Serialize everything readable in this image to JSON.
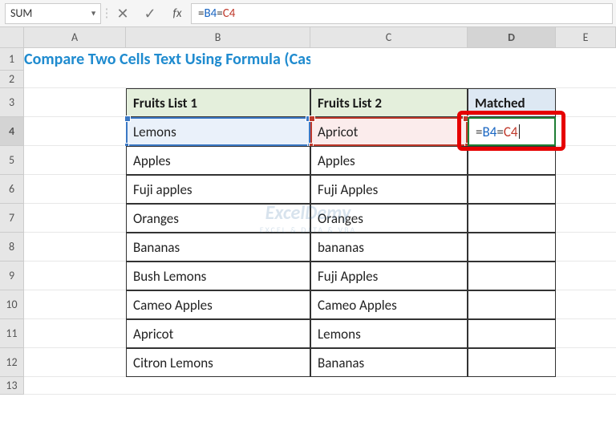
{
  "name_box": "SUM",
  "formula_bar": {
    "raw": "=B4=C4",
    "ref1": "B4",
    "ref2": "C4"
  },
  "columns": [
    "A",
    "B",
    "C",
    "D",
    "E"
  ],
  "rows": [
    "1",
    "2",
    "3",
    "4",
    "5",
    "6",
    "7",
    "8",
    "9",
    "10",
    "11",
    "12",
    "13"
  ],
  "title": "Compare Two Cells Text Using Formula (Case Insensitive)",
  "headers": {
    "b": "Fruits List 1",
    "c": "Fruits List 2",
    "d": "Matched"
  },
  "data": {
    "b": [
      "Lemons",
      "Apples",
      "Fuji apples",
      "Oranges",
      "Bananas",
      "Bush Lemons",
      "Cameo Apples",
      "Apricot",
      "Citron Lemons"
    ],
    "c": [
      "Apricot",
      "Apples",
      "Fuji Apples",
      "Oranges",
      "bananas",
      "Fuji Apples",
      "Cameo Apples",
      "Lemons",
      "Bananas"
    ]
  },
  "editing": {
    "cell": "D4",
    "text_eq": "=",
    "text_b": "B4",
    "text_mid": "=",
    "text_c": "C4"
  },
  "icons": {
    "dropdown": "▼",
    "cancel": "✕",
    "enter": "✓",
    "fx": "fx",
    "sep": "⋮"
  },
  "watermark": {
    "line1": "ExcelDemy",
    "line2": "EXCEL & DATA & VBA"
  },
  "active_column": "D",
  "active_row": "4"
}
